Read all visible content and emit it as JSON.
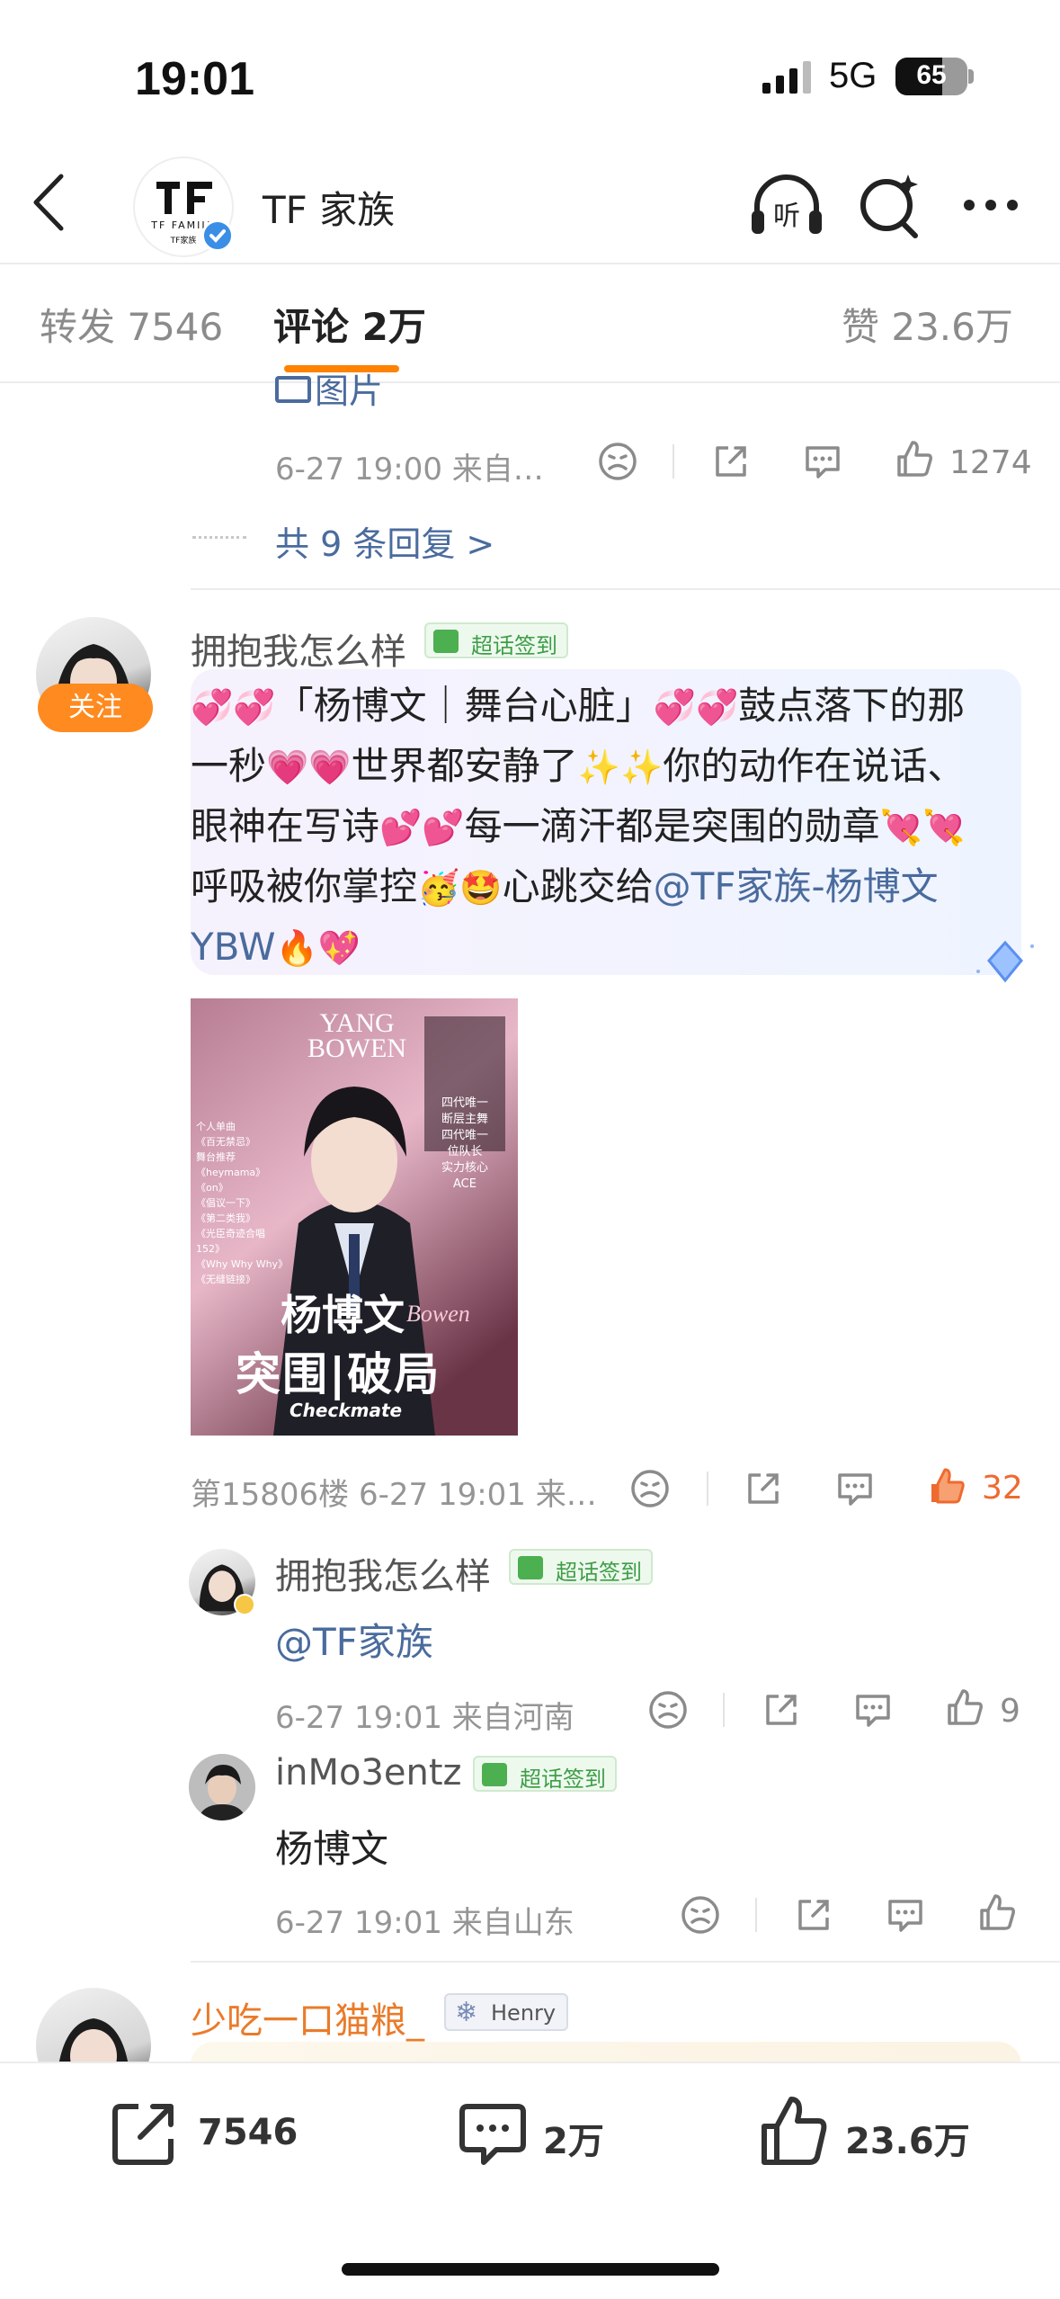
{
  "status": {
    "time": "19:01",
    "network": "5G",
    "battery": "65"
  },
  "header": {
    "title": "TF 家族",
    "logo_text": "TF FAMILY",
    "logo_sub": "TF家族"
  },
  "tabs": [
    {
      "label": "转发 7546"
    },
    {
      "label": "评论 2万"
    },
    {
      "label": "赞 23.6万"
    }
  ],
  "prev_comment": {
    "partial_text": "图片",
    "time": "6-27 19:00 来自…",
    "likes": "1274",
    "replies_link": "共 9 条回复 >"
  },
  "main_comment": {
    "user": "拥抱我怎么样",
    "badge": "超话签到",
    "follow": "关注",
    "text_parts": [
      "「杨博文｜舞台心脏」",
      "鼓点落下的那一秒",
      "世界都安静了",
      "你的动作在说话、眼神在写诗",
      "每一滴汗都是突围的勋章",
      "呼吸被你掌控",
      "心跳交给",
      "@TF家族-杨博文YBW"
    ],
    "poster": {
      "title_en_1": "YANG",
      "title_en_2": "BOWEN",
      "title_cn": "杨博文",
      "slogan": "突围|破局",
      "checkmate": "Checkmate",
      "bowen": "Bowen",
      "tags": [
        "四代唯一",
        "断层主舞",
        "四代唯一",
        "位队长",
        "实力核心",
        "ACE"
      ],
      "list": [
        "个人单曲",
        "《百无禁忌》",
        "舞台推荐",
        "《heymama》",
        "《on》",
        "《倡议一下》",
        "《第二类我》",
        "《光臣奇迹合唱152》",
        "《Why Why Why》",
        "《无缝链接》"
      ]
    },
    "floor": "第15806楼 6-27 19:01 来…",
    "likes": "32"
  },
  "replies": [
    {
      "user": "拥抱我怎么样",
      "badge": "超话签到",
      "text": "@TF家族",
      "time": "6-27 19:01 来自河南",
      "likes": "9"
    },
    {
      "user": "inMo3entz",
      "badge": "超话签到",
      "text": "杨博文",
      "time": "6-27 19:01 来自山东",
      "likes": ""
    }
  ],
  "next_comment": {
    "user": "少吃一口猫粮_",
    "badge": "Henry"
  },
  "bottom": {
    "repost": "7546",
    "comment": "2万",
    "like": "23.6万"
  },
  "colors": {
    "accent": "#ff8200",
    "link": "#4a6b9d",
    "liked": "#ee6a2f",
    "badge_green": "#3e9e48"
  }
}
